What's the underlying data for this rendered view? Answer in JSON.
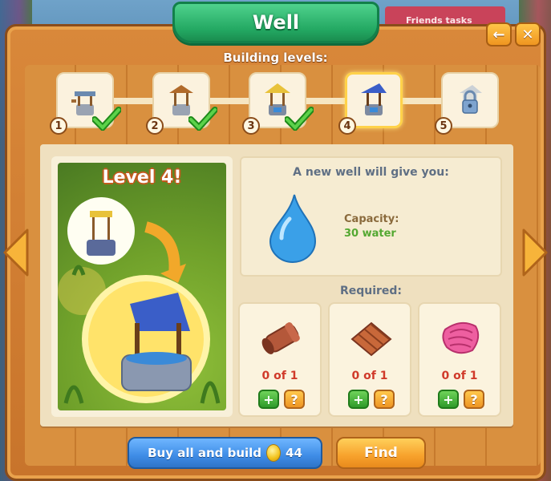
{
  "window": {
    "title": "Well",
    "bg_banner_text": "Friends tasks"
  },
  "levels": {
    "label": "Building levels:",
    "items": [
      {
        "number": "1",
        "completed": true,
        "locked": false,
        "active": false
      },
      {
        "number": "2",
        "completed": true,
        "locked": false,
        "active": false
      },
      {
        "number": "3",
        "completed": true,
        "locked": false,
        "active": false
      },
      {
        "number": "4",
        "completed": false,
        "locked": false,
        "active": true
      },
      {
        "number": "5",
        "completed": false,
        "locked": true,
        "active": false
      }
    ]
  },
  "preview": {
    "level_title": "Level 4!"
  },
  "gives": {
    "title": "A new well will give you:",
    "capacity_label": "Capacity:",
    "capacity_value": "30 water"
  },
  "required": {
    "label": "Required:",
    "items": [
      {
        "icon": "clay-pipe-icon",
        "count": "0 of 1"
      },
      {
        "icon": "roof-tiles-icon",
        "count": "0 of 1"
      },
      {
        "icon": "pink-cloth-icon",
        "count": "0 of 1"
      }
    ],
    "plus_label": "+",
    "help_label": "?"
  },
  "buttons": {
    "buy_label": "Buy all and build",
    "buy_price": "44",
    "find_label": "Find",
    "back_label": "←",
    "close_label": "✕"
  },
  "colors": {
    "title_green": "#23a862",
    "frame_orange": "#d9883a",
    "buy_blue": "#3e8ce6",
    "find_orange": "#f7a22c",
    "count_red": "#d03a2a",
    "capacity_green": "#54a832"
  }
}
